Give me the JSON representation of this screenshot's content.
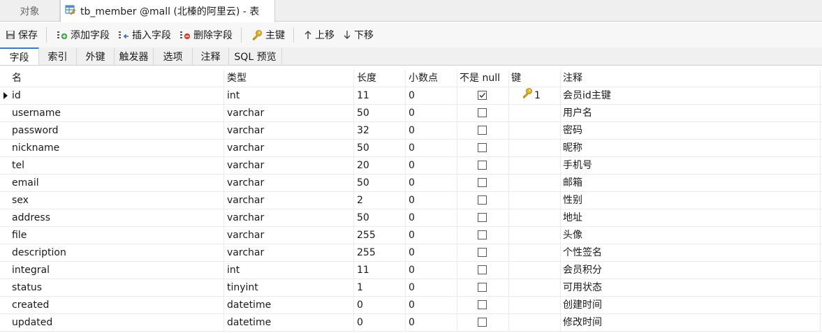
{
  "window_tabs": {
    "objects_label": "对象",
    "active_label": "tb_member @mall (北榛的阿里云) - 表"
  },
  "toolbar": {
    "save": "保存",
    "add_field": "添加字段",
    "insert_field": "插入字段",
    "delete_field": "删除字段",
    "primary_key": "主键",
    "move_up": "上移",
    "move_down": "下移"
  },
  "subtabs": {
    "fields": "字段",
    "indexes": "索引",
    "foreign_keys": "外键",
    "triggers": "触发器",
    "options": "选项",
    "comment": "注释",
    "sql_preview": "SQL 预览"
  },
  "grid": {
    "headers": {
      "name": "名",
      "type": "类型",
      "length": "长度",
      "decimals": "小数点",
      "not_null": "不是 null",
      "key": "键",
      "comment": "注释"
    },
    "rows": [
      {
        "name": "id",
        "type": "int",
        "length": "11",
        "decimals": "0",
        "not_null": true,
        "key": "1",
        "comment": "会员id主键"
      },
      {
        "name": "username",
        "type": "varchar",
        "length": "50",
        "decimals": "0",
        "not_null": false,
        "key": "",
        "comment": "用户名"
      },
      {
        "name": "password",
        "type": "varchar",
        "length": "32",
        "decimals": "0",
        "not_null": false,
        "key": "",
        "comment": "密码"
      },
      {
        "name": "nickname",
        "type": "varchar",
        "length": "50",
        "decimals": "0",
        "not_null": false,
        "key": "",
        "comment": "昵称"
      },
      {
        "name": "tel",
        "type": "varchar",
        "length": "20",
        "decimals": "0",
        "not_null": false,
        "key": "",
        "comment": "手机号"
      },
      {
        "name": "email",
        "type": "varchar",
        "length": "50",
        "decimals": "0",
        "not_null": false,
        "key": "",
        "comment": "邮箱"
      },
      {
        "name": "sex",
        "type": "varchar",
        "length": "2",
        "decimals": "0",
        "not_null": false,
        "key": "",
        "comment": "性别"
      },
      {
        "name": "address",
        "type": "varchar",
        "length": "50",
        "decimals": "0",
        "not_null": false,
        "key": "",
        "comment": "地址"
      },
      {
        "name": "file",
        "type": "varchar",
        "length": "255",
        "decimals": "0",
        "not_null": false,
        "key": "",
        "comment": "头像"
      },
      {
        "name": "description",
        "type": "varchar",
        "length": "255",
        "decimals": "0",
        "not_null": false,
        "key": "",
        "comment": "个性签名"
      },
      {
        "name": "integral",
        "type": "int",
        "length": "11",
        "decimals": "0",
        "not_null": false,
        "key": "",
        "comment": "会员积分"
      },
      {
        "name": "status",
        "type": "tinyint",
        "length": "1",
        "decimals": "0",
        "not_null": false,
        "key": "",
        "comment": "可用状态"
      },
      {
        "name": "created",
        "type": "datetime",
        "length": "0",
        "decimals": "0",
        "not_null": false,
        "key": "",
        "comment": "创建时间"
      },
      {
        "name": "updated",
        "type": "datetime",
        "length": "0",
        "decimals": "0",
        "not_null": false,
        "key": "",
        "comment": "修改时间"
      }
    ]
  },
  "colors": {
    "accent": "#2a7fd4",
    "key_gold": "#d9a516",
    "add_green": "#3aa34a",
    "delete_red": "#d9412b"
  },
  "icons": {
    "table_tab": "table-design-icon",
    "save": "save-disk-icon",
    "add_field": "add-field-icon",
    "insert_field": "insert-field-icon",
    "delete_field": "delete-field-icon",
    "primary_key": "key-icon",
    "move_up": "arrow-up-icon",
    "move_down": "arrow-down-icon"
  }
}
